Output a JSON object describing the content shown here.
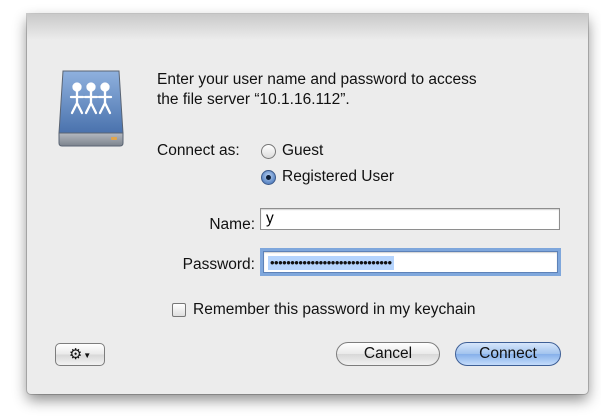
{
  "dialog": {
    "prompt_line1": "Enter your user name and password to access",
    "prompt_line2": "the file server “10.1.16.112”.",
    "connect_as_label": "Connect as:",
    "options": [
      {
        "label": "Guest",
        "selected": false
      },
      {
        "label": "Registered User",
        "selected": true
      }
    ],
    "name_label": "Name:",
    "name_value": "y",
    "password_label": "Password:",
    "password_mask": "••••••••••••••••••••••••••••••",
    "remember_label": "Remember this password in my keychain",
    "remember_checked": false,
    "cancel_label": "Cancel",
    "connect_label": "Connect",
    "action_icon": "gear-icon"
  },
  "colors": {
    "accent": "#86b0ea",
    "focus_ring": "#7fa7dc",
    "selection": "#b5d4fd",
    "sheet_bg": "#ececec"
  }
}
